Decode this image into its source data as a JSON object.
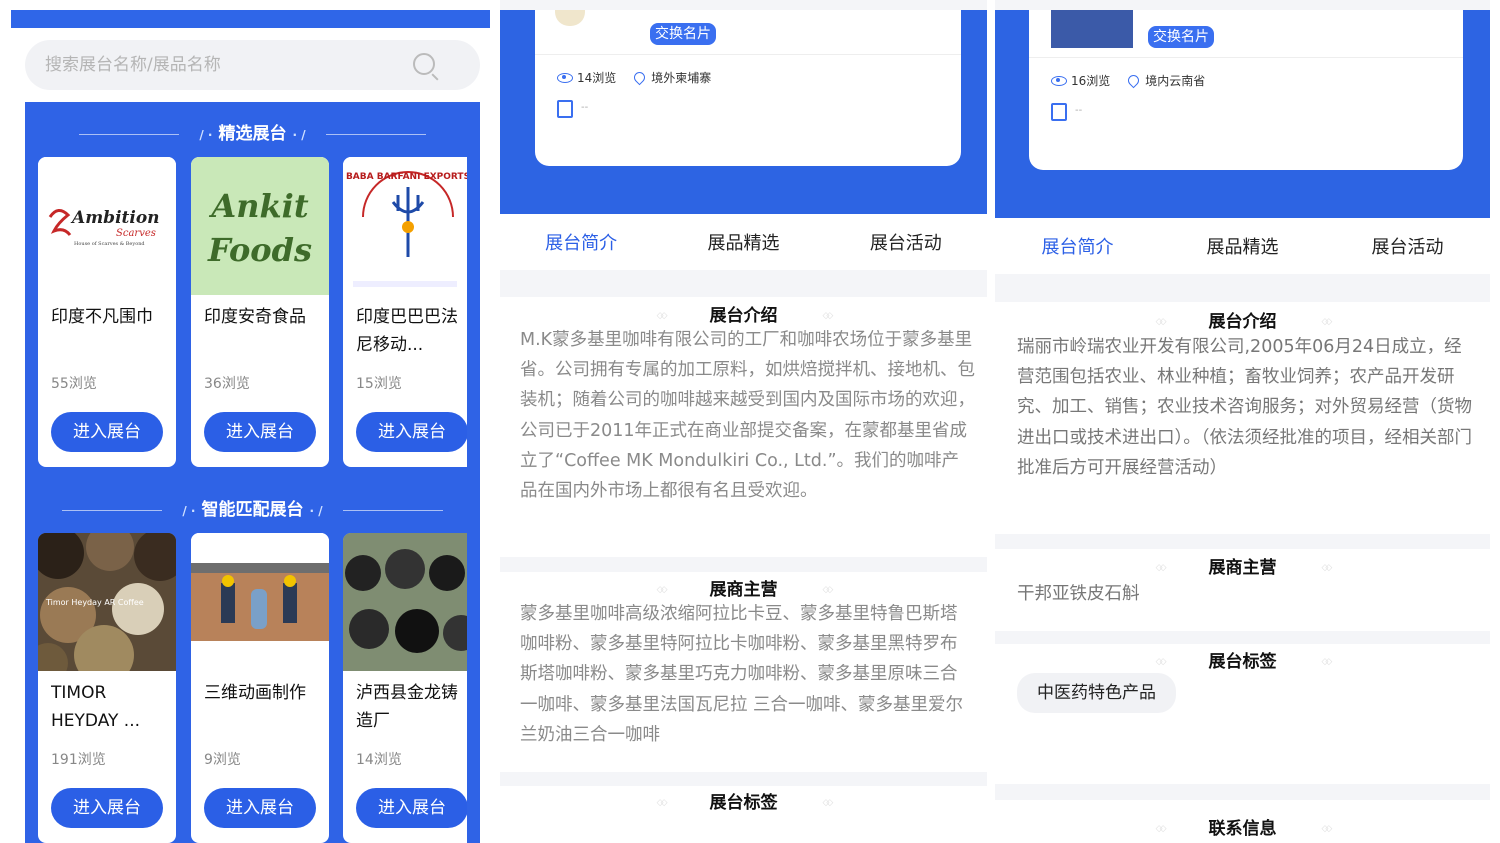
{
  "panel1": {
    "search": {
      "placeholder": "搜索展台名称/展品名称"
    },
    "featured_title": "精选展台",
    "matched_title": "智能匹配展台",
    "featured": [
      {
        "name": "印度不凡围巾",
        "views": "55浏览",
        "button": "进入展台",
        "logo_text": "Ambition",
        "logo_sub": "Scarves",
        "logo_tag": "House of Scarves & Beyond"
      },
      {
        "name": "印度安奇食品",
        "views": "36浏览",
        "button": "进入展台",
        "logo_text": "Ankit Foods"
      },
      {
        "name": "印度巴巴巴法尼移动...",
        "views": "15浏览",
        "button": "进入展台",
        "logo_text": "BABA BARFANI EXPORTS"
      }
    ],
    "matched": [
      {
        "name": "TIMOR HEYDAY ...",
        "views": "191浏览",
        "button": "进入展台",
        "image_caption": "Timor Heyday AR Coffee"
      },
      {
        "name": "三维动画制作",
        "views": "9浏览",
        "button": "进入展台"
      },
      {
        "name": "泸西县金龙铸造厂",
        "views": "14浏览",
        "button": "进入展台"
      }
    ]
  },
  "panel2": {
    "exchange_button": "交换名片",
    "views": "14浏览",
    "location": "境外柬埔寨",
    "address": "--",
    "tabs": [
      "展台简介",
      "展品精选",
      "展台活动"
    ],
    "intro_title": "展台介绍",
    "intro_text": "M.K蒙多基里咖啡有限公司的工厂和咖啡农场位于蒙多基里省。公司拥有专属的加工原料，如烘焙搅拌机、接地机、包装机；随着公司的咖啡越来越受到国内及国际市场的欢迎，公司已于2011年正式在商业部提交备案，在蒙都基里省成立了“Coffee MK Mondulkiri Co., Ltd.”。我们的咖啡产品在国内外市场上都很有名且受欢迎。",
    "business_title": "展商主营",
    "business_text": "蒙多基里咖啡高级浓缩阿拉比卡豆、蒙多基里特鲁巴斯塔咖啡粉、蒙多基里特阿拉比卡咖啡粉、蒙多基里黑特罗布斯塔咖啡粉、蒙多基里巧克力咖啡粉、蒙多基里原味三合一咖啡、蒙多基里法国瓦尼拉 三合一咖啡、蒙多基里爱尔兰奶油三合一咖啡",
    "tags_title": "展台标签"
  },
  "panel3": {
    "exchange_button": "交换名片",
    "views": "16浏览",
    "location": "境内云南省",
    "address": "--",
    "tabs": [
      "展台简介",
      "展品精选",
      "展台活动"
    ],
    "intro_title": "展台介绍",
    "intro_text": "瑞丽市岭瑞农业开发有限公司,2005年06月24日成立，经营范围包括农业、林业种植；畜牧业饲养；农产品开发研究、加工、销售；农业技术咨询服务；对外贸易经营（货物进出口或技术进出口）。（依法须经批准的项目，经相关部门批准后方可开展经营活动）",
    "business_title": "展商主营",
    "business_text": "干邦亚铁皮石斛",
    "tags_title": "展台标签",
    "tag": "中医药特色产品",
    "contact_title": "联系信息"
  },
  "colors": {
    "accent": "#2b5fe6",
    "hero": "#2d64e3",
    "text_muted": "#8a8a8a"
  }
}
